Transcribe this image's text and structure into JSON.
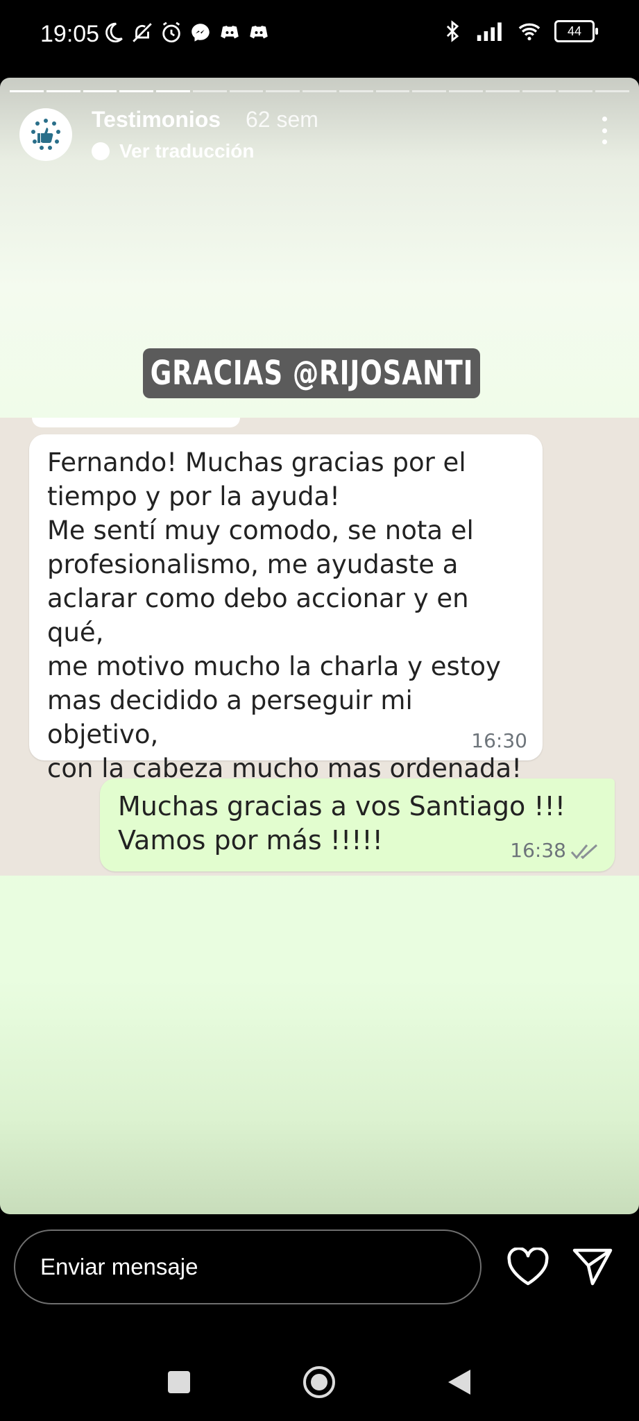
{
  "status_bar": {
    "time": "19:05",
    "battery_level": "44",
    "left_icons": [
      "moon-icon",
      "bell-off-icon",
      "alarm-icon",
      "messenger-icon",
      "discord-icon",
      "discord-icon"
    ],
    "right_icons": [
      "bluetooth-icon",
      "signal-icon",
      "wifi-icon",
      "battery-icon"
    ]
  },
  "story": {
    "progress_segments_total": 17,
    "progress_segments_viewed": 5,
    "username": "Testimonios",
    "time_ago": "62 sem",
    "translate_label": "Ver traducción",
    "sticker_text": "GRACIAS @RIJOSANTI"
  },
  "chat": {
    "incoming": {
      "text": "Fernando! Muchas gracias por el\ntiempo y por la ayuda!\nMe sentí muy comodo, se nota el\nprofesionalismo, me ayudaste a\naclarar como debo accionar y en qué,\nme motivo mucho la charla y estoy\nmas decidido a perseguir mi objetivo,\ncon la cabeza mucho mas ordenada!",
      "time": "16:30"
    },
    "outgoing": {
      "text": "Muchas gracias a vos Santiago !!!\nVamos por más !!!!!",
      "time": "16:38",
      "status_icon": "double-check-icon"
    }
  },
  "reply_bar": {
    "placeholder": "Enviar mensaje"
  },
  "nav": {
    "buttons": [
      "recents-button",
      "home-button",
      "back-button"
    ]
  },
  "colors": {
    "incoming_bubble": "#ffffff",
    "outgoing_bubble": "#e2fdcf",
    "chat_background": "#ebe5dd",
    "story_background": "#eafde0"
  }
}
